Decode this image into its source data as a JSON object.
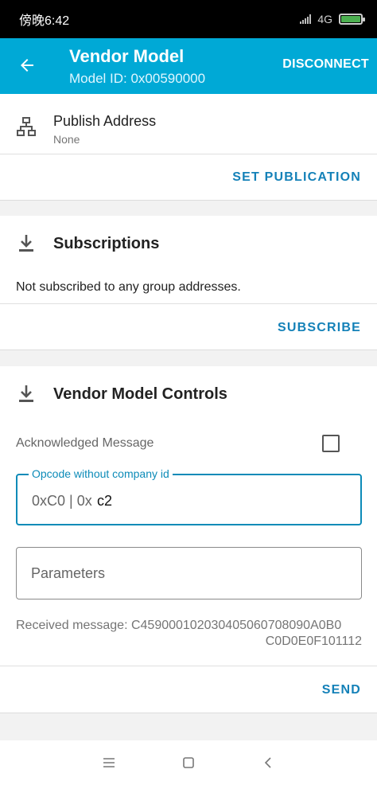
{
  "status": {
    "time": "傍晚6:42",
    "network": "4G"
  },
  "header": {
    "title": "Vendor Model",
    "subtitle": "Model ID: 0x00590000",
    "disconnect_label": "DISCONNECT",
    "color": "#00a9d6"
  },
  "publish": {
    "title": "Publish Address",
    "value": "None",
    "action_label": "SET PUBLICATION"
  },
  "subscriptions": {
    "title": "Subscriptions",
    "message": "Not subscribed to any group addresses.",
    "action_label": "SUBSCRIBE"
  },
  "controls": {
    "title": "Vendor Model Controls",
    "ack_label": "Acknowledged Message",
    "opcode": {
      "label": "Opcode without company id",
      "prefix": "0xC0 | 0x",
      "value": "c2"
    },
    "parameters": {
      "placeholder": "Parameters"
    },
    "received_label": "Received message: C4590001020304050607080",
    "received_line1": "Received message: C45900010203040506070809 0A0B0",
    "received_text_1": "Received message: C459000102030405060708090A0B0",
    "received_text_2": "C0D0E0F101112",
    "send_label": "SEND"
  },
  "accent_color": "#1481b8"
}
